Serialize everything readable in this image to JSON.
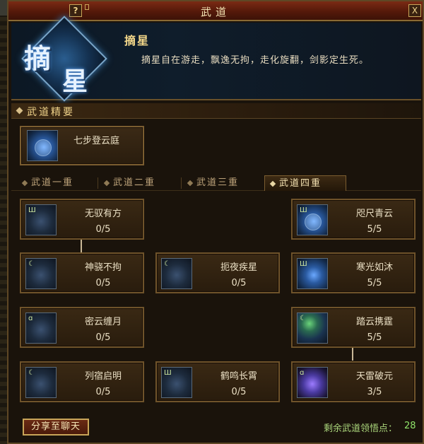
{
  "window": {
    "title": "武道",
    "help_label": "?",
    "close_label": "X"
  },
  "header": {
    "emblem_glyph_1": "摘",
    "emblem_glyph_2": "星",
    "skill_name": "摘星",
    "skill_desc": "摘星自在游走，飘逸无拘，走化旋翻，剑影定生死。"
  },
  "section": {
    "title": "武道精要"
  },
  "featured": {
    "label": "七步登云庭",
    "icon": "figure-aura-icon"
  },
  "tabs": [
    {
      "label": "武道一重",
      "active": false
    },
    {
      "label": "武道二重",
      "active": false
    },
    {
      "label": "武道三重",
      "active": false
    },
    {
      "label": "武道四重",
      "active": true
    }
  ],
  "talents": [
    {
      "name": "无驭有方",
      "rank": "0/5",
      "icon": "boot-icon"
    },
    {
      "name": "咫尺青云",
      "rank": "5/5",
      "icon": "figure-aura-icon"
    },
    {
      "name": "神骁不拘",
      "rank": "0/5",
      "icon": "boot-icon"
    },
    {
      "name": "扼夜疾星",
      "rank": "0/5",
      "icon": "orbs-icon"
    },
    {
      "name": "寒光如沐",
      "rank": "5/5",
      "icon": "streak-icon"
    },
    {
      "name": "密云缠月",
      "rank": "0/5",
      "icon": "swirl-icon"
    },
    {
      "name": "踏云携霆",
      "rank": "5/5",
      "icon": "green-feather-icon"
    },
    {
      "name": "列宿启明",
      "rank": "0/5",
      "icon": "orbs-icon"
    },
    {
      "name": "鹤鸣长霄",
      "rank": "0/5",
      "icon": "scroll-icon"
    },
    {
      "name": "天雷破元",
      "rank": "3/5",
      "icon": "fist-icon"
    }
  ],
  "footer": {
    "share_label": "分享至聊天",
    "points_label": "剩余武道领悟点：",
    "points_value": "28"
  }
}
